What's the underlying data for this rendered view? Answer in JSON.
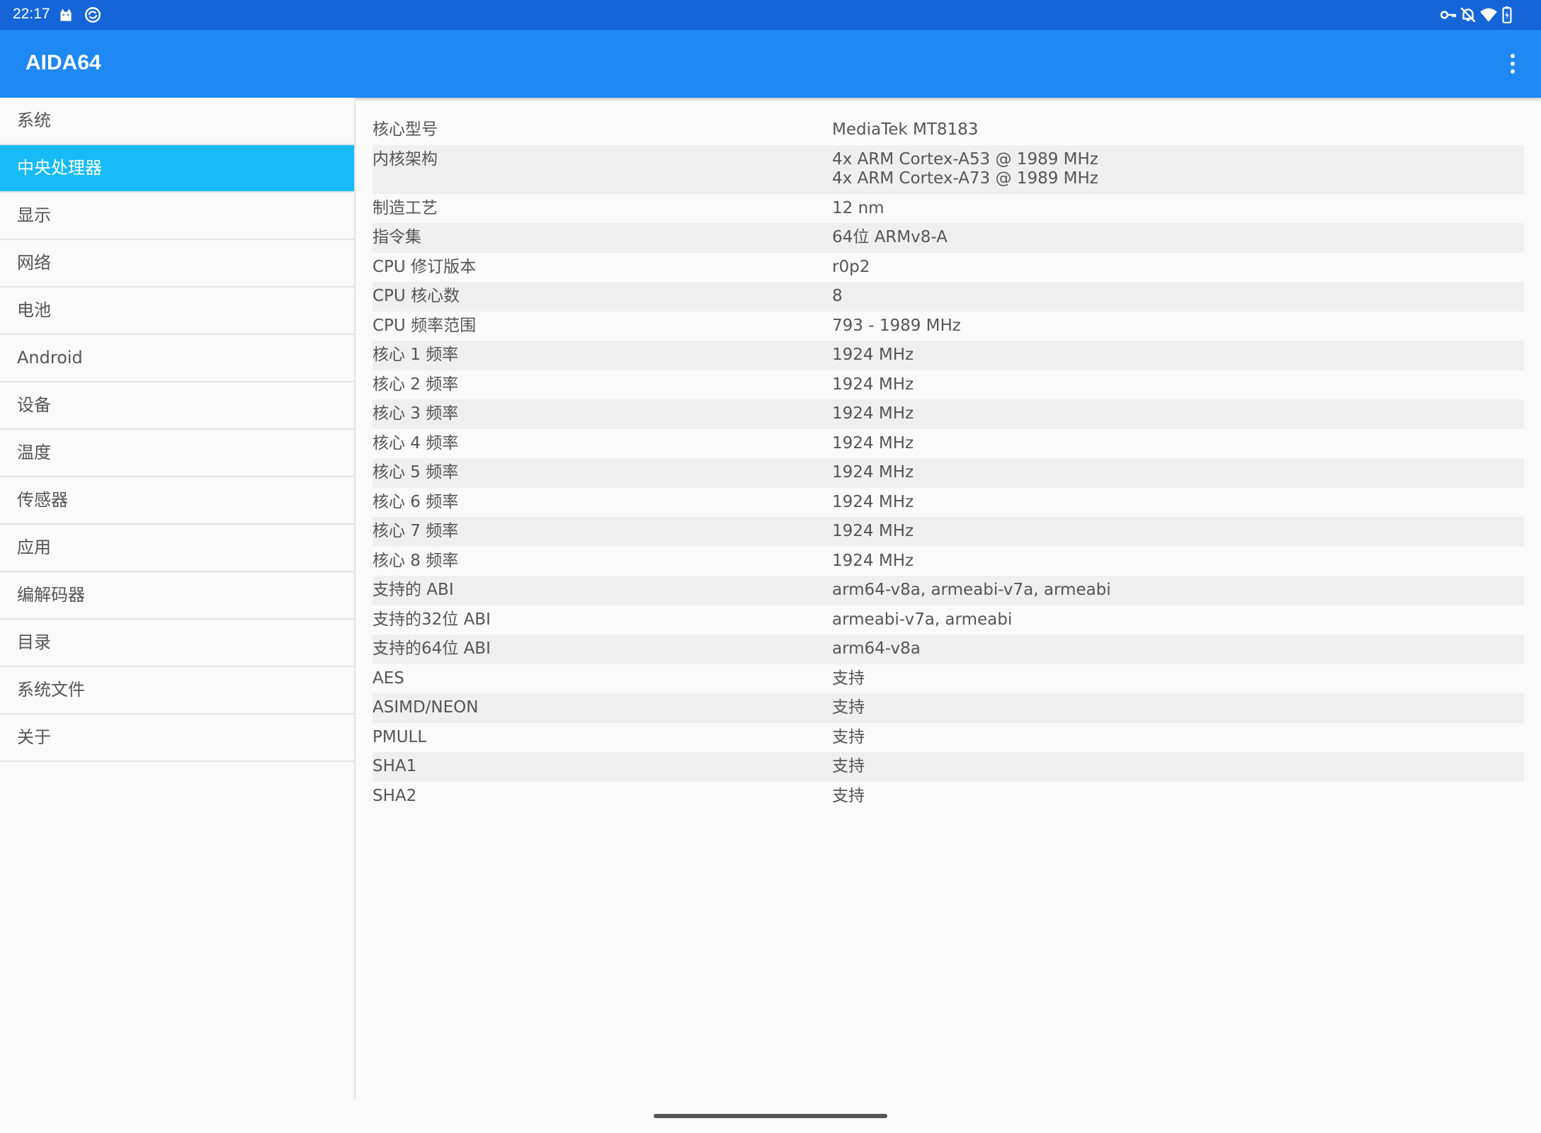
{
  "status_bar": {
    "time": "22:17",
    "left_icons": [
      "android-cat-icon",
      "sync-icon"
    ],
    "right_icons": [
      "vpn-key-icon",
      "notifications-off-icon",
      "wifi-icon",
      "battery-charging-icon"
    ]
  },
  "app_bar": {
    "title": "AIDA64",
    "menu_icon": "more-vert-icon",
    "color": "#1e88f5"
  },
  "sidebar": {
    "accent": "#16bbf8",
    "selected": "中央处理器",
    "items": [
      {
        "label": "系统"
      },
      {
        "label": "中央处理器"
      },
      {
        "label": "显示"
      },
      {
        "label": "网络"
      },
      {
        "label": "电池"
      },
      {
        "label": "Android"
      },
      {
        "label": "设备"
      },
      {
        "label": "温度"
      },
      {
        "label": "传感器"
      },
      {
        "label": "应用"
      },
      {
        "label": "编解码器"
      },
      {
        "label": "目录"
      },
      {
        "label": "系统文件"
      },
      {
        "label": "关于"
      }
    ]
  },
  "cpu_info": {
    "rows": [
      {
        "label": "核心型号",
        "value": "MediaTek MT8183"
      },
      {
        "label": "内核架构",
        "value": "4x ARM Cortex-A53 @ 1989 MHz\n4x ARM Cortex-A73 @ 1989 MHz"
      },
      {
        "label": "制造工艺",
        "value": "12 nm"
      },
      {
        "label": "指令集",
        "value": "64位 ARMv8-A"
      },
      {
        "label": "CPU 修订版本",
        "value": "r0p2"
      },
      {
        "label": "CPU 核心数",
        "value": "8"
      },
      {
        "label": "CPU 频率范围",
        "value": "793 - 1989 MHz"
      },
      {
        "label": "核心 1 频率",
        "value": "1924 MHz"
      },
      {
        "label": "核心 2 频率",
        "value": "1924 MHz"
      },
      {
        "label": "核心 3 频率",
        "value": "1924 MHz"
      },
      {
        "label": "核心 4 频率",
        "value": "1924 MHz"
      },
      {
        "label": "核心 5 频率",
        "value": "1924 MHz"
      },
      {
        "label": "核心 6 频率",
        "value": "1924 MHz"
      },
      {
        "label": "核心 7 频率",
        "value": "1924 MHz"
      },
      {
        "label": "核心 8 频率",
        "value": "1924 MHz"
      },
      {
        "label": "支持的 ABI",
        "value": "arm64-v8a, armeabi-v7a, armeabi"
      },
      {
        "label": "支持的32位 ABI",
        "value": "armeabi-v7a, armeabi"
      },
      {
        "label": "支持的64位 ABI",
        "value": "arm64-v8a"
      },
      {
        "label": "AES",
        "value": "支持"
      },
      {
        "label": "ASIMD/NEON",
        "value": "支持"
      },
      {
        "label": "PMULL",
        "value": "支持"
      },
      {
        "label": "SHA1",
        "value": "支持"
      },
      {
        "label": "SHA2",
        "value": "支持"
      }
    ]
  }
}
